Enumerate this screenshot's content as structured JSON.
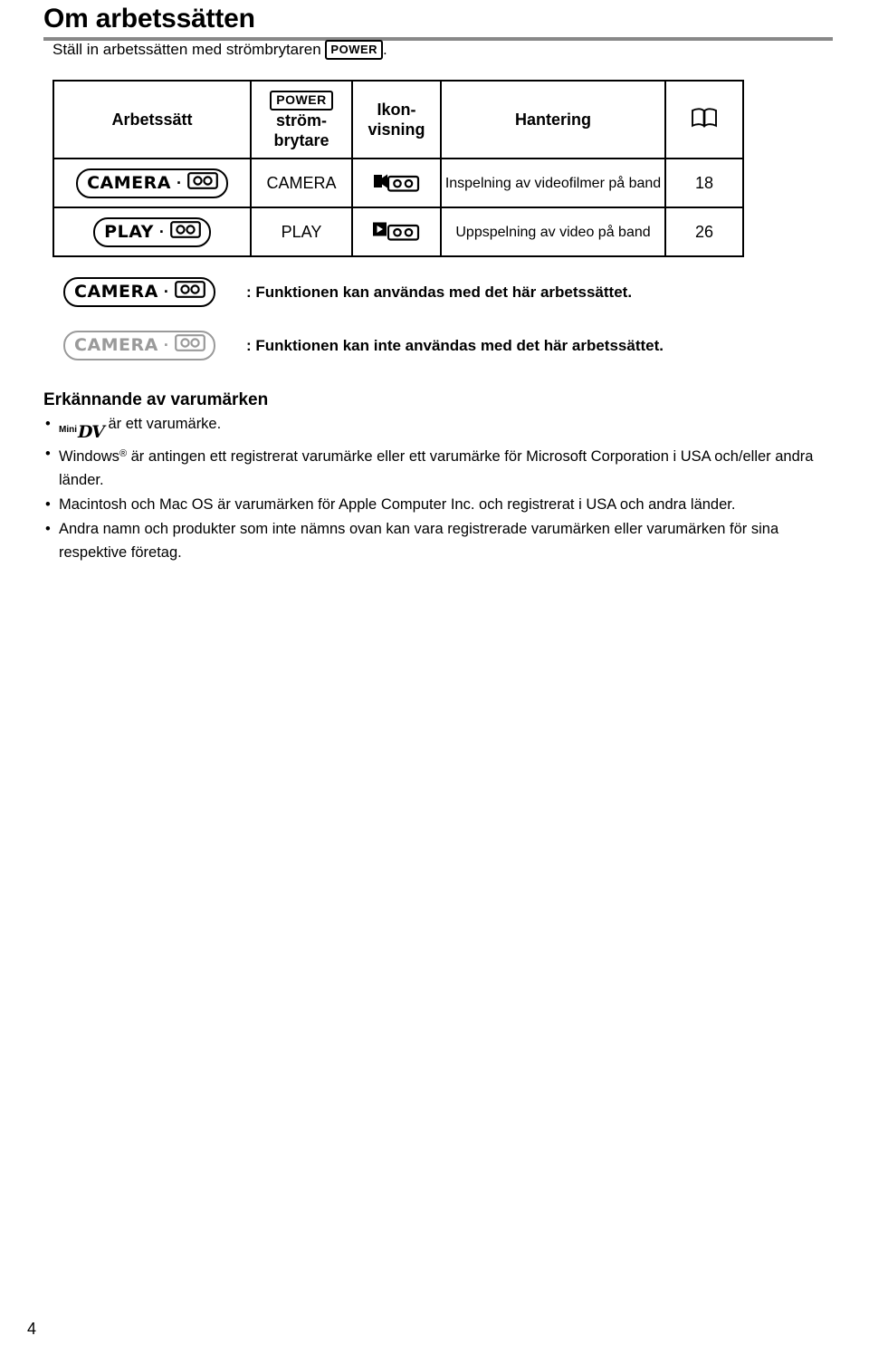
{
  "document": {
    "title": "Om arbetssätten",
    "intro_prefix": "Ställ in arbetssätten med strömbrytaren",
    "intro_badge": "POWER",
    "intro_suffix": ".",
    "page_number": "4"
  },
  "table": {
    "headers": {
      "mode": "Arbetssätt",
      "power_badge": "POWER",
      "power_line1": "ström-",
      "power_line2": "brytare",
      "icon_line1": "Ikon-",
      "icon_line2": "visning",
      "handling": "Hantering",
      "page": "book-icon"
    },
    "rows": [
      {
        "mode_label": "CAMERA",
        "mode_icon": "tape-icon",
        "power": "CAMERA",
        "icon_display": "camera-tape-icon",
        "handling": "Inspelning av videofilmer på band",
        "page": "18"
      },
      {
        "mode_label": "PLAY",
        "mode_icon": "tape-icon",
        "power": "PLAY",
        "icon_display": "play-tape-icon",
        "handling": "Uppspelning av video på band",
        "page": "26"
      }
    ]
  },
  "legend": {
    "available": {
      "mode_label": "CAMERA",
      "text": ": Funktionen kan användas med det här arbetssättet."
    },
    "unavailable": {
      "mode_label": "CAMERA",
      "text": ": Funktionen kan inte användas med det här arbetssättet."
    }
  },
  "trademarks": {
    "heading": "Erkännande av varumärken",
    "items": [
      {
        "prefix_icon": "mini-dv-logo",
        "mini_text": "Mini",
        "dv_text": "DV",
        "text": "är ett varumärke."
      },
      {
        "text_a": "Windows",
        "sup": "®",
        "text_b": " är antingen ett registrerat varumärke eller ett varumärke för Microsoft Corporation i USA och/eller andra länder."
      },
      {
        "text": "Macintosh och Mac OS är varumärken för Apple Computer Inc. och registrerat i USA och andra länder."
      },
      {
        "text": "Andra namn och produkter som inte nämns ovan kan vara registrerade varumärken eller varumärken för sina respektive företag."
      }
    ]
  }
}
